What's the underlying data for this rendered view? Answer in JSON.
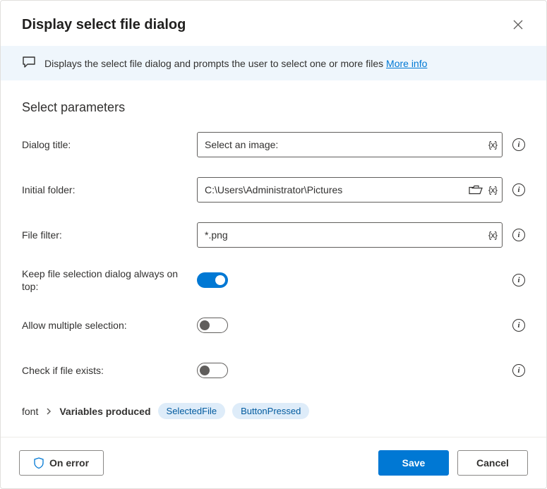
{
  "dialog": {
    "title": "Display select file dialog",
    "banner_text": "Displays the select file dialog and prompts the user to select one or more files",
    "more_info": "More info"
  },
  "section": {
    "title": "Select parameters"
  },
  "fields": {
    "dialog_title": {
      "label": "Dialog title:",
      "value": "Select an image:"
    },
    "initial_folder": {
      "label": "Initial folder:",
      "value": "C:\\Users\\Administrator\\Pictures"
    },
    "file_filter": {
      "label": "File filter:",
      "value": "*.png"
    },
    "always_on_top": {
      "label": "Keep file selection dialog always on top:",
      "on": true
    },
    "multiple": {
      "label": "Allow multiple selection:",
      "on": false
    },
    "check_exists": {
      "label": "Check if file exists:",
      "on": false
    }
  },
  "variables": {
    "label": "Variables produced",
    "items": [
      "SelectedFile",
      "ButtonPressed"
    ]
  },
  "footer": {
    "on_error": "On error",
    "save": "Save",
    "cancel": "Cancel"
  }
}
